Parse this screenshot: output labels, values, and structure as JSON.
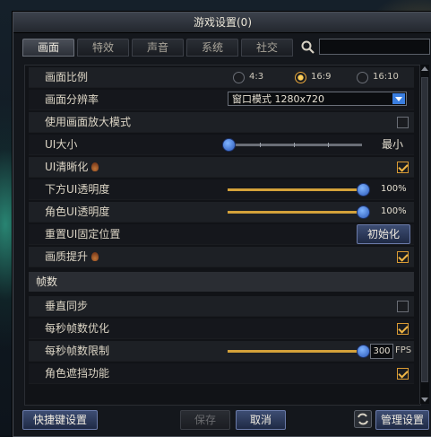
{
  "window": {
    "title": "游戏设置(0)"
  },
  "tabs": [
    {
      "label": "画面",
      "active": true
    },
    {
      "label": "特效",
      "active": false
    },
    {
      "label": "声音",
      "active": false
    },
    {
      "label": "系统",
      "active": false
    },
    {
      "label": "社交",
      "active": false
    }
  ],
  "search": {
    "value": "",
    "placeholder": ""
  },
  "settings": {
    "aspect_ratio": {
      "label": "画面比例",
      "options": [
        "4:3",
        "16:9",
        "16:10"
      ],
      "selected": "16:9"
    },
    "resolution": {
      "label": "画面分辨率",
      "value": "窗口模式 1280x720"
    },
    "zoom_mode": {
      "label": "使用画面放大模式",
      "checked": false
    },
    "ui_size": {
      "label": "UI大小",
      "value_label": "最小",
      "level": 0
    },
    "ui_sharpen": {
      "label": "UI清晰化",
      "checked": true
    },
    "bottom_ui_opacity": {
      "label": "下方UI透明度",
      "value": "100%",
      "level": 1.0
    },
    "char_ui_opacity": {
      "label": "角色UI透明度",
      "value": "100%",
      "level": 1.0
    },
    "reset_ui": {
      "label": "重置UI固定位置",
      "button": "初始化"
    },
    "quality_boost": {
      "label": "画质提升",
      "checked": true
    },
    "frames_section": {
      "label": "帧数"
    },
    "vsync": {
      "label": "垂直同步",
      "checked": false
    },
    "fps_optimize": {
      "label": "每秒帧数优化",
      "checked": true
    },
    "fps_limit": {
      "label": "每秒帧数限制",
      "value": "300",
      "unit": "FPS",
      "level": 1.0
    },
    "char_occlusion": {
      "label": "角色遮挡功能",
      "checked": true
    }
  },
  "footer": {
    "shortcut": "快捷键设置",
    "save": "保存",
    "cancel": "取消",
    "manage": "管理设置"
  },
  "colors": {
    "accent": "#f0b645",
    "slider_thumb": "#2b58b8",
    "select_arrow": "#3a7ee0"
  }
}
